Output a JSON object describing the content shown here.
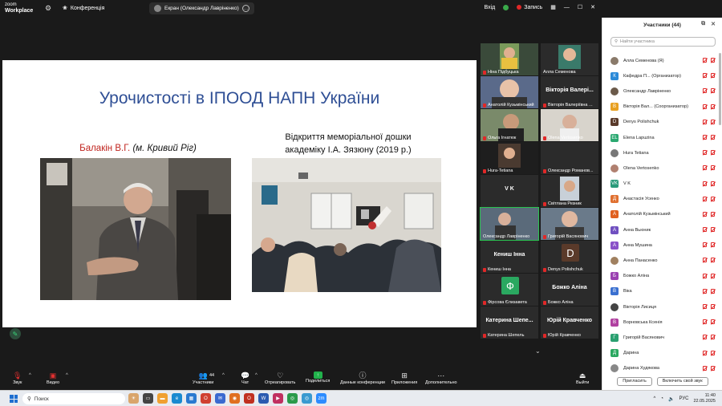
{
  "topbar": {
    "logo_line1": "zoom",
    "logo_line2": "Workplace",
    "conference_label": "Конференція",
    "screen_label": "Екран (Олександр Лавріненко)",
    "login_label": "Вхід",
    "record_label": "Запись"
  },
  "slide": {
    "title": "Урочистості в ІПООД НАПН України",
    "left_caption_name": "Балакін В.Г.",
    "left_caption_place": "(м. Кривий Ріг)",
    "right_caption_line1": "Відкриття меморіальної дошки",
    "right_caption_line2": "академіку І.А. Зязюну (2019 р.)"
  },
  "gallery": {
    "tiles": [
      {
        "name": "Ніна Підбуцька",
        "big": ""
      },
      {
        "name": "Алла Семенова",
        "big": ""
      },
      {
        "name": "Анатолій Кузьмінський",
        "big": ""
      },
      {
        "name": "Вікторія Валеріївна ...",
        "big": "Вікторія Валері..."
      },
      {
        "name": "Ольга Ігнатюк",
        "big": ""
      },
      {
        "name": "Olena Vertosenko",
        "big": ""
      },
      {
        "name": "Нura-Tetiana",
        "big": ""
      },
      {
        "name": "Олександр Романов...",
        "big": ""
      },
      {
        "name": "",
        "big": "V K"
      },
      {
        "name": "Світлана Резник",
        "big": ""
      },
      {
        "name": "Олександр Лавріненко",
        "big": ""
      },
      {
        "name": "Григорій Васянович",
        "big": ""
      },
      {
        "name": "Кениш Інна",
        "big": "Кениш Інна"
      },
      {
        "name": "Denys Polishchuk",
        "big": "",
        "letter": "D"
      },
      {
        "name": "Фірсова Єлизавета",
        "big": "",
        "letter": "Ф"
      },
      {
        "name": "Божко Аліна",
        "big": "Божко Аліна"
      },
      {
        "name": "Катерина Шепель",
        "big": "Катерина Шепе..."
      },
      {
        "name": "Юрій Кравченко",
        "big": "Юрій Кравченко"
      }
    ]
  },
  "panel": {
    "title": "Участники (44)",
    "search_placeholder": "Найти участника",
    "participants": [
      {
        "name": "Алла Семенова (Я)",
        "avatar": "",
        "color": "#8a7a6a"
      },
      {
        "name": "Кафедра П... (Организатор)",
        "avatar": "К",
        "color": "#2b8ad8"
      },
      {
        "name": "Олександр Лавріненко",
        "avatar": "",
        "color": "#6b5a4a"
      },
      {
        "name": "Вікторія Вал... (Соорганизатор)",
        "avatar": "В",
        "color": "#e8a020"
      },
      {
        "name": "Denys Polishchuk",
        "avatar": "D",
        "color": "#5a3a2a"
      },
      {
        "name": "Elena Lapuzina",
        "avatar": "EL",
        "color": "#2aa870"
      },
      {
        "name": "Нura Tetiana",
        "avatar": "",
        "color": "#777"
      },
      {
        "name": "Olena Vertosenko",
        "avatar": "",
        "color": "#b08070"
      },
      {
        "name": "V K",
        "avatar": "VK",
        "color": "#2a9a7a"
      },
      {
        "name": "Анастасія Усенко",
        "avatar": "Д",
        "color": "#e07030"
      },
      {
        "name": "Анатолій Кузьмінський",
        "avatar": "А",
        "color": "#e06020"
      },
      {
        "name": "Анна Вьюник",
        "avatar": "А",
        "color": "#7050c0"
      },
      {
        "name": "Анна Мушина",
        "avatar": "А",
        "color": "#8a50c8"
      },
      {
        "name": "Анна Панасенко",
        "avatar": "",
        "color": "#a08060"
      },
      {
        "name": "Божко Аліна",
        "avatar": "Б",
        "color": "#9a40b0"
      },
      {
        "name": "Віка",
        "avatar": "В",
        "color": "#3a70d0"
      },
      {
        "name": "Вікторія Лисиця",
        "avatar": "",
        "color": "#444"
      },
      {
        "name": "Ворновська Ксенія",
        "avatar": "В",
        "color": "#b040a0"
      },
      {
        "name": "Григорій Васянович",
        "avatar": "Г",
        "color": "#2aa070"
      },
      {
        "name": "Дарина",
        "avatar": "Д",
        "color": "#2aa860"
      },
      {
        "name": "Дарина Худякова",
        "avatar": "",
        "color": "#888"
      }
    ],
    "invite_label": "Пригласить",
    "unmute_all_label": "Включить свой звук"
  },
  "toolbar": {
    "audio_label": "Звук",
    "video_label": "Видео",
    "participants_label": "Участники",
    "participants_count": "44",
    "chat_label": "Чат",
    "react_label": "Отреагировать",
    "share_label": "Поделиться",
    "info_label": "Данные конференции",
    "apps_label": "Приложения",
    "more_label": "Дополнительно",
    "exit_label": "Выйти"
  },
  "taskbar": {
    "search_label": "Поиск",
    "lang": "РУС",
    "time": "11:40",
    "date": "22.05.2025"
  }
}
